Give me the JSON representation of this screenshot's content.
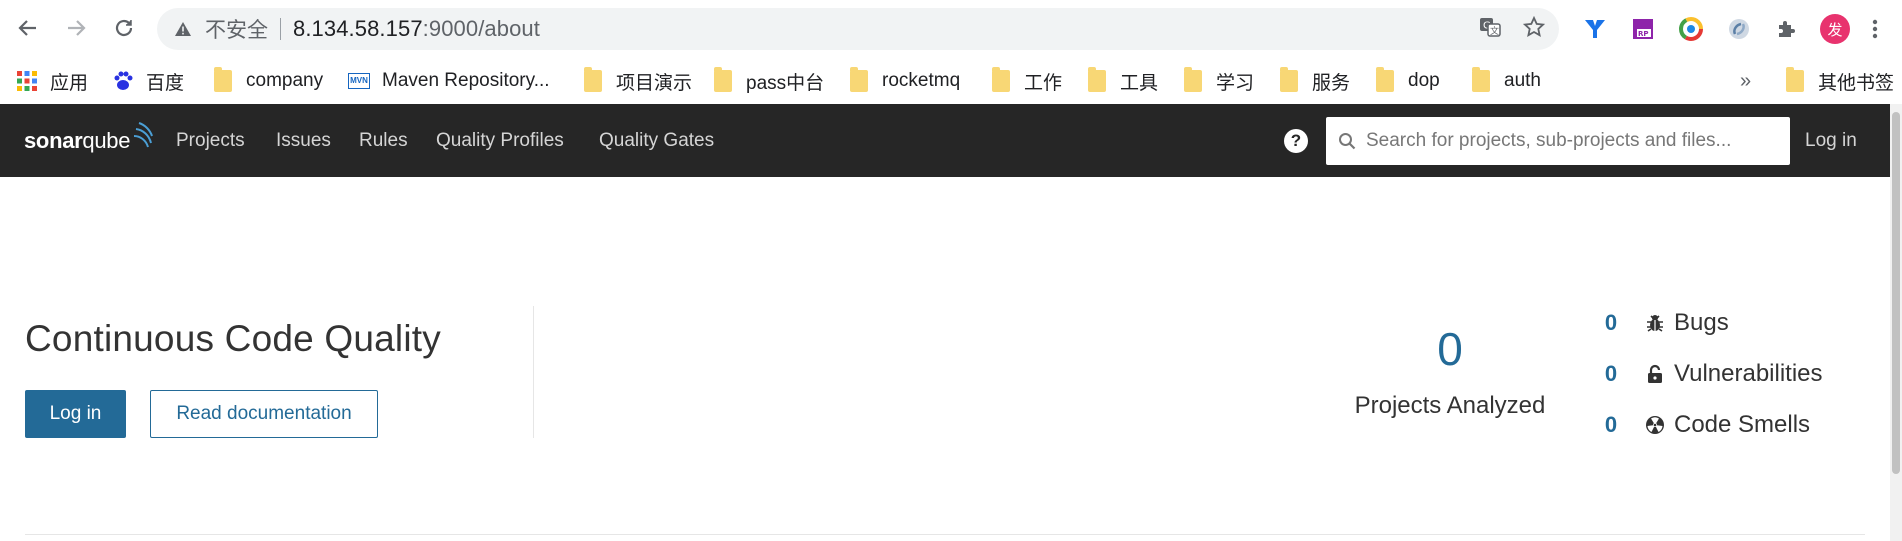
{
  "browser": {
    "back_icon": "back-arrow-icon",
    "forward_icon": "forward-arrow-icon",
    "reload_icon": "reload-icon",
    "insecure_label": "不安全",
    "url_host": "8.134.58.157",
    "url_rest": ":9000/about",
    "extensions": [
      "filter-extension",
      "rp-extension",
      "chrome-color-extension",
      "sync-extension"
    ],
    "avatar_letter": "发"
  },
  "bookmarks": {
    "items": [
      {
        "label": "应用",
        "icon": "apps-grid-icon"
      },
      {
        "label": "百度",
        "icon": "baidu-paw-icon"
      },
      {
        "label": "company",
        "icon": "folder-icon"
      },
      {
        "label": "Maven Repository...",
        "icon": "mvn-icon"
      },
      {
        "label": "项目演示",
        "icon": "folder-icon"
      },
      {
        "label": "pass中台",
        "icon": "folder-icon"
      },
      {
        "label": "rocketmq",
        "icon": "folder-icon"
      },
      {
        "label": "工作",
        "icon": "folder-icon"
      },
      {
        "label": "工具",
        "icon": "folder-icon"
      },
      {
        "label": "学习",
        "icon": "folder-icon"
      },
      {
        "label": "服务",
        "icon": "folder-icon"
      },
      {
        "label": "dop",
        "icon": "folder-icon"
      },
      {
        "label": "auth",
        "icon": "folder-icon"
      }
    ],
    "overflow": "»",
    "other": "其他书签",
    "mvn_text": "MVN"
  },
  "sonar": {
    "logo_bold": "sonar",
    "logo_light": "qube",
    "nav": [
      "Projects",
      "Issues",
      "Rules",
      "Quality Profiles",
      "Quality Gates"
    ],
    "help": "?",
    "search_placeholder": "Search for projects, sub-projects and files...",
    "login": "Log in"
  },
  "hero": {
    "title": "Continuous Code Quality",
    "login_button": "Log in",
    "docs_button": "Read documentation",
    "projects_count": "0",
    "projects_label": "Projects Analyzed",
    "metrics": [
      {
        "value": "0",
        "label": "Bugs",
        "icon": "bug-icon"
      },
      {
        "value": "0",
        "label": "Vulnerabilities",
        "icon": "lock-open-icon"
      },
      {
        "value": "0",
        "label": "Code Smells",
        "icon": "radiation-icon"
      }
    ]
  },
  "colors": {
    "sonar_nav_bg": "#262626",
    "sonar_blue": "#236a97",
    "folder_yellow": "#f8d775"
  }
}
